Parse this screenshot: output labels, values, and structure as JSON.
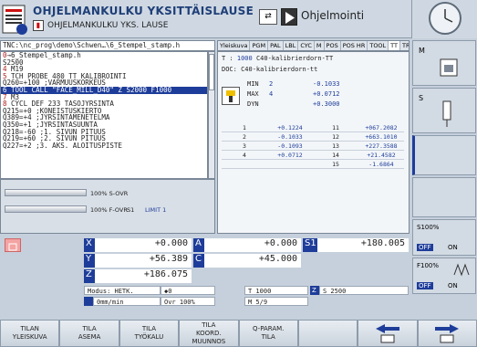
{
  "header": {
    "mode_title": "OHJELMANKULKU YKSITTÄISLAUSE",
    "mode_sub": "OHJELMANKULKU YKS. LAUSE",
    "prog_title": "Ohjelmointi"
  },
  "program": {
    "path": "TNC:\\nc_prog\\demo\\Schwen…\\6_Stempel_stamp.h",
    "lines": [
      {
        "num": "0",
        "text": "→6_Stempel_stamp.h",
        "sel": false,
        "first": true
      },
      {
        "num": "",
        "text": "  S2500",
        "sel": false
      },
      {
        "num": "4",
        "text": " M19",
        "sel": false
      },
      {
        "num": "5",
        "text": " TCH PROBE 480 TT KALIBROINTI",
        "sel": false
      },
      {
        "num": "",
        "text": "   Q260=+100  ;VARMUUSKORKEUS",
        "sel": false
      },
      {
        "num": "6",
        "text": " TOOL CALL \"FACE_MILL_D40\" Z S2000 F1000",
        "sel": true
      },
      {
        "num": "7",
        "text": " M3",
        "sel": false
      },
      {
        "num": "8",
        "text": " CYCL DEF 233 TASOJYRSINTA",
        "sel": false
      },
      {
        "num": "",
        "text": "   Q215=+0    ;KONEISTUSKIERTO",
        "sel": false
      },
      {
        "num": "",
        "text": "   Q389=+4    ;JYRSINTAMENETELMA",
        "sel": false
      },
      {
        "num": "",
        "text": "   Q350=+1    ;JYRSINTASUUNTA",
        "sel": false
      },
      {
        "num": "",
        "text": "   Q218=-60   ;1. SIVUN PITUUS",
        "sel": false
      },
      {
        "num": "",
        "text": "   Q219=+60   ;2. SIVUN PITUUS",
        "sel": false
      },
      {
        "num": "",
        "text": "   Q227=+2    ;3. AKS. ALOITUSPISTE",
        "sel": false
      }
    ]
  },
  "overrides": {
    "s_ovr": "100% S-OVR",
    "f_ovr": "100% F-OVR",
    "s1": "S1",
    "limit": "LIMIT 1"
  },
  "tabs": [
    "Yleiskuva",
    "PGM",
    "PAL",
    "LBL",
    "CYC",
    "M",
    "POS",
    "POS HR",
    "TOOL",
    "TT",
    "TRANS"
  ],
  "status": {
    "t_label": "T :",
    "t_num": "1000",
    "t_name": "C40-kalibrierdorn-TT",
    "doc_label": "DOC:",
    "doc_val": "C40-kalibrierdorn-tt",
    "min_label": "MIN",
    "min_a": "2",
    "min_b": "-0.1033",
    "max_label": "MAX",
    "max_a": "4",
    "max_b": "+0.0712",
    "dyn_label": "DYN",
    "dyn_b": "+0.3000",
    "table": [
      [
        "1",
        "+0.1224",
        "11",
        "+067.2082"
      ],
      [
        "2",
        "-0.1033",
        "12",
        "+663.1010"
      ],
      [
        "3",
        "-0.1093",
        "13",
        "+227.3588"
      ],
      [
        "4",
        "+0.0712",
        "14",
        "+21.4582"
      ],
      [
        "",
        "",
        "15",
        "-1.6864"
      ]
    ]
  },
  "axes": {
    "x_name": "X",
    "x_val": "+0.000",
    "a_name": "A",
    "a_val": "+0.000",
    "s1_name": "S1",
    "s1_val": "+180.005",
    "y_name": "Y",
    "y_val": "+56.389",
    "c_name": "C",
    "c_val": "+45.000",
    "z_name": "Z",
    "z_val": "+186.075"
  },
  "state": {
    "modus": "Modus: HETK.",
    "zero": "◆0",
    "t": "T 1000",
    "z": "Z",
    "s": "S 2500",
    "feed": "0mm/min",
    "ovr": "Ovr 100%",
    "m": "M 5/9"
  },
  "side": {
    "s100": "S100%",
    "f100": "F100%",
    "off": "OFF",
    "on": "ON",
    "m_label": "M",
    "s_label": "S"
  },
  "softkeys": [
    "TILAN\nYLEISKUVA",
    "TILA\nASEMA",
    "TILA\nTYÖKALU",
    "TILA\nKOORD.\nMUUNNOS",
    "Q-PARAM.\nTILA",
    "",
    "",
    ""
  ]
}
